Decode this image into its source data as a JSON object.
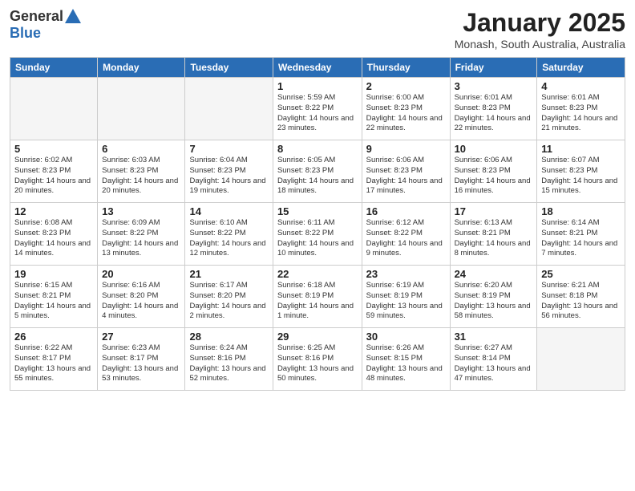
{
  "logo": {
    "general": "General",
    "blue": "Blue"
  },
  "header": {
    "month": "January 2025",
    "location": "Monash, South Australia, Australia"
  },
  "days_of_week": [
    "Sunday",
    "Monday",
    "Tuesday",
    "Wednesday",
    "Thursday",
    "Friday",
    "Saturday"
  ],
  "weeks": [
    [
      {
        "day": "",
        "info": ""
      },
      {
        "day": "",
        "info": ""
      },
      {
        "day": "",
        "info": ""
      },
      {
        "day": "1",
        "info": "Sunrise: 5:59 AM\nSunset: 8:22 PM\nDaylight: 14 hours and 23 minutes."
      },
      {
        "day": "2",
        "info": "Sunrise: 6:00 AM\nSunset: 8:23 PM\nDaylight: 14 hours and 22 minutes."
      },
      {
        "day": "3",
        "info": "Sunrise: 6:01 AM\nSunset: 8:23 PM\nDaylight: 14 hours and 22 minutes."
      },
      {
        "day": "4",
        "info": "Sunrise: 6:01 AM\nSunset: 8:23 PM\nDaylight: 14 hours and 21 minutes."
      }
    ],
    [
      {
        "day": "5",
        "info": "Sunrise: 6:02 AM\nSunset: 8:23 PM\nDaylight: 14 hours and 20 minutes."
      },
      {
        "day": "6",
        "info": "Sunrise: 6:03 AM\nSunset: 8:23 PM\nDaylight: 14 hours and 20 minutes."
      },
      {
        "day": "7",
        "info": "Sunrise: 6:04 AM\nSunset: 8:23 PM\nDaylight: 14 hours and 19 minutes."
      },
      {
        "day": "8",
        "info": "Sunrise: 6:05 AM\nSunset: 8:23 PM\nDaylight: 14 hours and 18 minutes."
      },
      {
        "day": "9",
        "info": "Sunrise: 6:06 AM\nSunset: 8:23 PM\nDaylight: 14 hours and 17 minutes."
      },
      {
        "day": "10",
        "info": "Sunrise: 6:06 AM\nSunset: 8:23 PM\nDaylight: 14 hours and 16 minutes."
      },
      {
        "day": "11",
        "info": "Sunrise: 6:07 AM\nSunset: 8:23 PM\nDaylight: 14 hours and 15 minutes."
      }
    ],
    [
      {
        "day": "12",
        "info": "Sunrise: 6:08 AM\nSunset: 8:23 PM\nDaylight: 14 hours and 14 minutes."
      },
      {
        "day": "13",
        "info": "Sunrise: 6:09 AM\nSunset: 8:22 PM\nDaylight: 14 hours and 13 minutes."
      },
      {
        "day": "14",
        "info": "Sunrise: 6:10 AM\nSunset: 8:22 PM\nDaylight: 14 hours and 12 minutes."
      },
      {
        "day": "15",
        "info": "Sunrise: 6:11 AM\nSunset: 8:22 PM\nDaylight: 14 hours and 10 minutes."
      },
      {
        "day": "16",
        "info": "Sunrise: 6:12 AM\nSunset: 8:22 PM\nDaylight: 14 hours and 9 minutes."
      },
      {
        "day": "17",
        "info": "Sunrise: 6:13 AM\nSunset: 8:21 PM\nDaylight: 14 hours and 8 minutes."
      },
      {
        "day": "18",
        "info": "Sunrise: 6:14 AM\nSunset: 8:21 PM\nDaylight: 14 hours and 7 minutes."
      }
    ],
    [
      {
        "day": "19",
        "info": "Sunrise: 6:15 AM\nSunset: 8:21 PM\nDaylight: 14 hours and 5 minutes."
      },
      {
        "day": "20",
        "info": "Sunrise: 6:16 AM\nSunset: 8:20 PM\nDaylight: 14 hours and 4 minutes."
      },
      {
        "day": "21",
        "info": "Sunrise: 6:17 AM\nSunset: 8:20 PM\nDaylight: 14 hours and 2 minutes."
      },
      {
        "day": "22",
        "info": "Sunrise: 6:18 AM\nSunset: 8:19 PM\nDaylight: 14 hours and 1 minute."
      },
      {
        "day": "23",
        "info": "Sunrise: 6:19 AM\nSunset: 8:19 PM\nDaylight: 13 hours and 59 minutes."
      },
      {
        "day": "24",
        "info": "Sunrise: 6:20 AM\nSunset: 8:19 PM\nDaylight: 13 hours and 58 minutes."
      },
      {
        "day": "25",
        "info": "Sunrise: 6:21 AM\nSunset: 8:18 PM\nDaylight: 13 hours and 56 minutes."
      }
    ],
    [
      {
        "day": "26",
        "info": "Sunrise: 6:22 AM\nSunset: 8:17 PM\nDaylight: 13 hours and 55 minutes."
      },
      {
        "day": "27",
        "info": "Sunrise: 6:23 AM\nSunset: 8:17 PM\nDaylight: 13 hours and 53 minutes."
      },
      {
        "day": "28",
        "info": "Sunrise: 6:24 AM\nSunset: 8:16 PM\nDaylight: 13 hours and 52 minutes."
      },
      {
        "day": "29",
        "info": "Sunrise: 6:25 AM\nSunset: 8:16 PM\nDaylight: 13 hours and 50 minutes."
      },
      {
        "day": "30",
        "info": "Sunrise: 6:26 AM\nSunset: 8:15 PM\nDaylight: 13 hours and 48 minutes."
      },
      {
        "day": "31",
        "info": "Sunrise: 6:27 AM\nSunset: 8:14 PM\nDaylight: 13 hours and 47 minutes."
      },
      {
        "day": "",
        "info": ""
      }
    ]
  ]
}
